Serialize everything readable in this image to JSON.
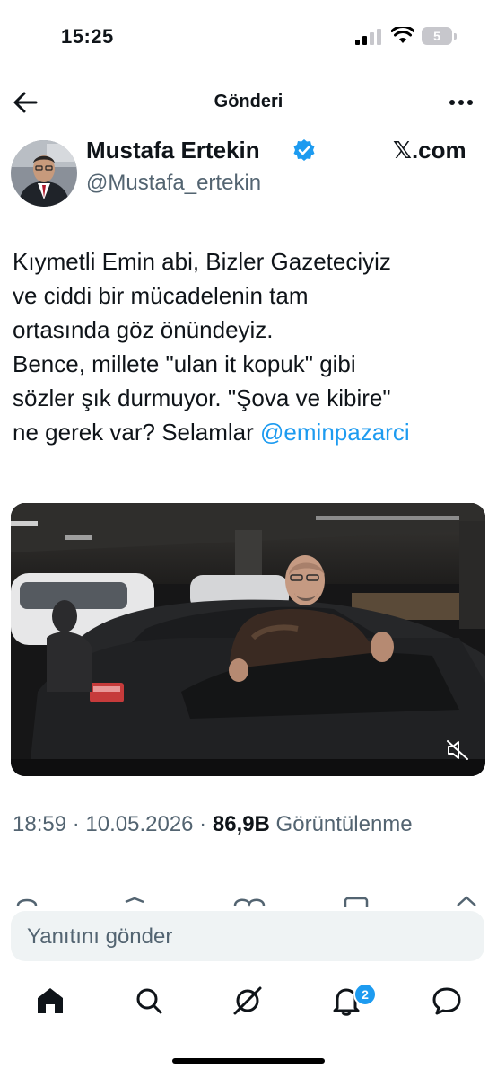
{
  "status_bar": {
    "time": "15:25",
    "battery": "5"
  },
  "header": {
    "title": "Gönderi"
  },
  "author": {
    "name": "Mustafa Ertekin",
    "handle": "@Mustafa_ertekin",
    "source": "𝕏.com"
  },
  "tweet": {
    "text": "Kıymetli Emin abi, Bizler Gazeteciyiz\nve ciddi bir mücadelenin tam\nortasında göz önündeyiz.\nBence, millete \"ulan it kopuk\" gibi\nsözler şık durmuyor. \"Şova ve kibire\"\nne gerek var? Selamlar ",
    "mention": "@eminpazarci"
  },
  "meta": {
    "time": "18:59",
    "sep1": " · ",
    "date": "10.05.2026",
    "sep2": " · ",
    "views": "86,9B",
    "views_label": " Görüntülenme"
  },
  "reply": {
    "placeholder": "Yanıtını gönder"
  },
  "nav": {
    "notifications_badge": "2"
  },
  "colors": {
    "accent": "#1d9bf0",
    "text": "#0f1419",
    "secondary": "#536471"
  }
}
